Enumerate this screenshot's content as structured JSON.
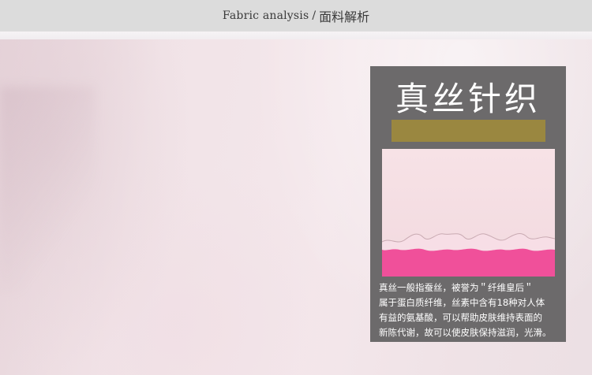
{
  "header": {
    "title_en": "Fabric analysis",
    "separator": "/",
    "title_cn": "面料解析"
  },
  "card": {
    "title": "真丝针织",
    "description_lines": [
      "真丝一般指蚕丝，被誉为＂纤维皇后＂",
      "属于蛋白质纤维，丝素中含有18种对人体",
      "有益的氨基酸，可以帮助皮肤维持表面的",
      "新陈代谢，故可以使皮肤保持滋润，光滑。"
    ]
  },
  "colors": {
    "header_bg": "#dcdcdc",
    "card_bg": "#6c6a6b",
    "gold_bar": "#9a8740",
    "swatch_light_pink": "#f4dde2",
    "swatch_hot_pink": "#f0509a",
    "background_pink": "#f1e3e7"
  }
}
